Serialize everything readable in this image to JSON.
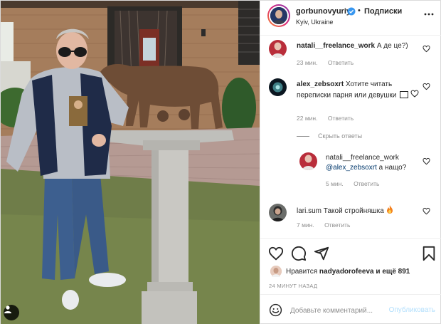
{
  "header": {
    "username": "gorbunovyuriy",
    "dot": "•",
    "follow_label": "Подписки",
    "location": "Kyiv, Ukraine"
  },
  "comments": [
    {
      "username": "natali__freelance_work",
      "text": "А де це?)",
      "time": "23 мин.",
      "reply_label": "Ответить"
    },
    {
      "username": "alex_zebsoxrt",
      "text": "Хотите читать переписки парня или девушки",
      "time": "22 мин.",
      "reply_label": "Ответить"
    },
    {
      "username": "natali__freelance_work",
      "mention": "@alex_zebsoxrt",
      "text": "а нащо?",
      "time": "5 мин.",
      "reply_label": "Ответить"
    },
    {
      "username": "lari.sum",
      "text": "Такой стройняшка",
      "time": "7 мин.",
      "reply_label": "Ответить"
    }
  ],
  "hide_replies_label": "Скрыть ответы",
  "likes": {
    "prefix": "Нравится",
    "user": "nadyadorofeeva",
    "suffix": "и ещё 891"
  },
  "time_ago": "24 МИНУТ НАЗАД",
  "add_comment": {
    "placeholder": "Добавьте комментарий...",
    "publish_label": "Опубликовать"
  },
  "icons": {
    "verified": "verified-badge-icon",
    "more": "more-options-icon",
    "like": "heart-icon",
    "comment": "comment-icon",
    "share": "share-icon",
    "save": "bookmark-icon",
    "emoji": "emoji-icon",
    "user_tag": "user-tag-icon"
  },
  "colors": {
    "accent": "#0095f6",
    "accent_disabled": "#b2dffc",
    "muted": "#8e8e8e",
    "text": "#262626",
    "border": "#efefef"
  }
}
